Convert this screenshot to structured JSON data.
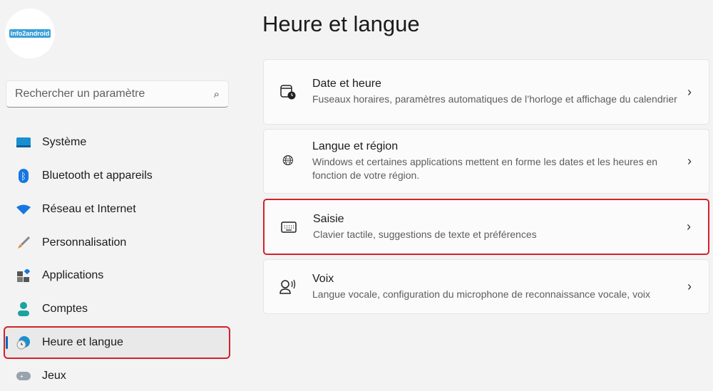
{
  "logo": {
    "text": "info2android"
  },
  "search": {
    "placeholder": "Rechercher un paramètre",
    "icon": "search-icon"
  },
  "sidebar": {
    "items": [
      {
        "label": "Système",
        "icon": "monitor-icon"
      },
      {
        "label": "Bluetooth et appareils",
        "icon": "bluetooth-icon"
      },
      {
        "label": "Réseau et Internet",
        "icon": "wifi-icon"
      },
      {
        "label": "Personnalisation",
        "icon": "brush-icon"
      },
      {
        "label": "Applications",
        "icon": "apps-icon"
      },
      {
        "label": "Comptes",
        "icon": "person-icon"
      },
      {
        "label": "Heure et langue",
        "icon": "globe-clock-icon",
        "active": true
      },
      {
        "label": "Jeux",
        "icon": "gamepad-icon"
      }
    ]
  },
  "main": {
    "title": "Heure et langue",
    "cards": [
      {
        "title": "Date et heure",
        "desc": "Fuseaux horaires, paramètres automatiques de l’horloge et affichage du calendrier",
        "icon": "calendar-clock-icon"
      },
      {
        "title": "Langue et région",
        "desc": "Windows et certaines applications mettent en forme les dates et les heures en fonction de votre région.",
        "icon": "language-icon"
      },
      {
        "title": "Saisie",
        "desc": "Clavier tactile, suggestions de texte et préférences",
        "icon": "keyboard-icon",
        "highlighted": true
      },
      {
        "title": "Voix",
        "desc": "Langue vocale, configuration du microphone de reconnaissance vocale, voix",
        "icon": "speech-icon"
      }
    ]
  },
  "colors": {
    "highlight": "#d3202a",
    "accent": "#0067c0"
  }
}
